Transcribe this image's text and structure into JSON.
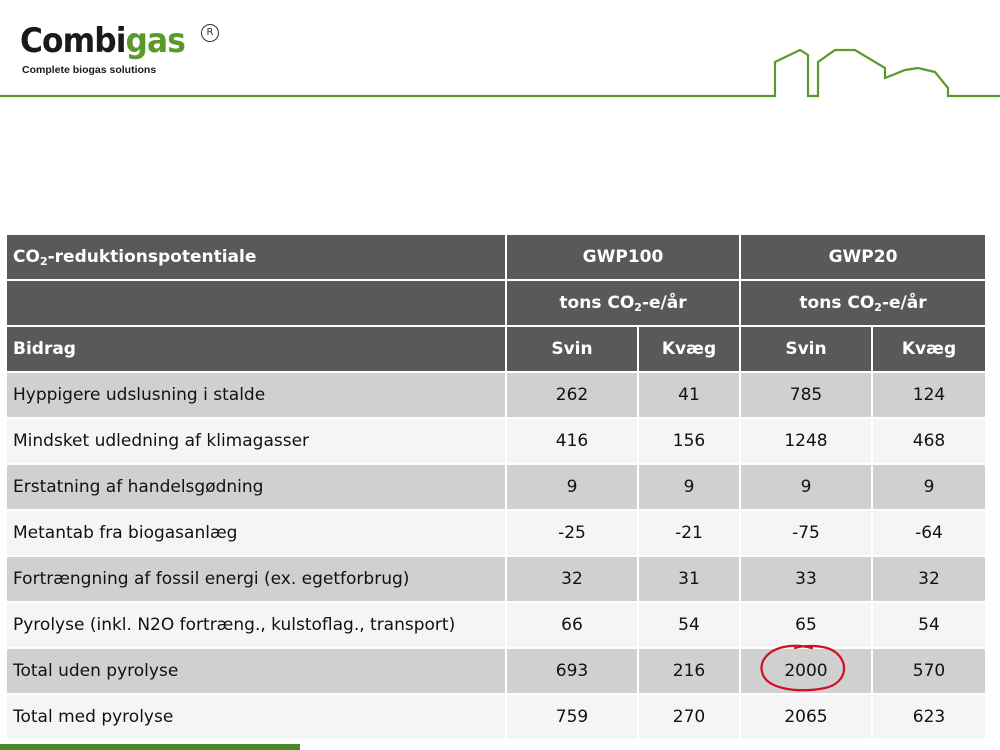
{
  "logo": {
    "word_part1": "Combi",
    "word_part2": "gas",
    "registered": "R",
    "tagline": "Complete biogas solutions"
  },
  "colors": {
    "brand_green": "#5a9a2a",
    "header_cell": "#595959",
    "row_shade": "#d0d0d0",
    "annotation_red": "#d01020"
  },
  "table": {
    "title": "CO",
    "title_sub": "2",
    "title_rest": "-reduktionspotentiale",
    "gwp100": "GWP100",
    "gwp20": "GWP20",
    "unit_pre": "tons CO",
    "unit_sub": "2",
    "unit_post": "-e/år",
    "bidrag": "Bidrag",
    "svin": "Svin",
    "kvaeg": "Kvæg",
    "rows": [
      {
        "label": "Hyppigere udslusning i stalde",
        "v": [
          "262",
          "41",
          "785",
          "124"
        ]
      },
      {
        "label": "Mindsket udledning af klimagasser",
        "v": [
          "416",
          "156",
          "1248",
          "468"
        ]
      },
      {
        "label": "Erstatning af handelsgødning",
        "v": [
          "9",
          "9",
          "9",
          "9"
        ]
      },
      {
        "label": "Metantab fra biogasanlæg",
        "v": [
          "-25",
          "-21",
          "-75",
          "-64"
        ]
      },
      {
        "label": "Fortrængning af fossil energi (ex. egetforbrug)",
        "v": [
          "32",
          "31",
          "33",
          "32"
        ]
      },
      {
        "label": "Pyrolyse (inkl. N2O fortræng., kulstoflag., transport)",
        "v": [
          "66",
          "54",
          "65",
          "54"
        ]
      },
      {
        "label": "Total uden pyrolyse",
        "v": [
          "693",
          "216",
          "2000",
          "570"
        ]
      },
      {
        "label": "Total med pyrolyse",
        "v": [
          "759",
          "270",
          "2065",
          "623"
        ]
      }
    ]
  }
}
